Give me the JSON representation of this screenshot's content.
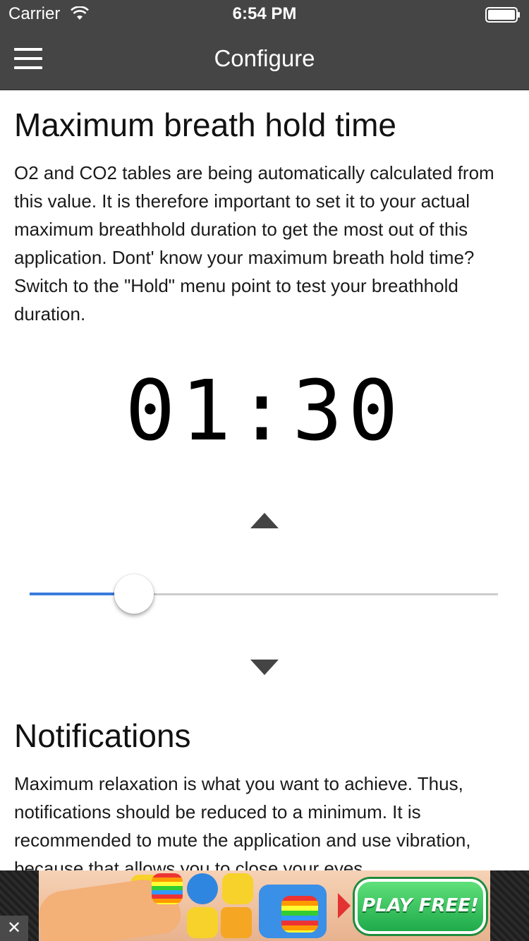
{
  "status_bar": {
    "carrier": "Carrier",
    "time": "6:54 PM"
  },
  "nav": {
    "title": "Configure"
  },
  "breath_hold": {
    "title": "Maximum breath hold time",
    "description": "O2 and CO2 tables are being automatically calculated from this value. It is therefore important to set it to your actual maximum breathhold duration to get the most out of this application. Dont' know your maximum breath hold time? Switch to the \"Hold\" menu point to test your breathhold duration.",
    "timer_value": "01:30",
    "slider_fraction": 0.18
  },
  "notifications": {
    "title": "Notifications",
    "description": "Maximum relaxation is what you want to achieve. Thus, notifications should be reduced to a minimum. It is recommended to mute the application and use vibration, because that allows you to close your eyes."
  },
  "ad": {
    "close_glyph": "✕",
    "cta_label": "PLAY FREE!"
  },
  "colors": {
    "nav_background": "#454545",
    "slider_accent": "#3a7bdc",
    "arrow_color": "#444444"
  },
  "icons": [
    "wifi-icon",
    "battery-icon",
    "menu-icon",
    "arrow-up-icon",
    "arrow-down-icon",
    "close-icon"
  ]
}
